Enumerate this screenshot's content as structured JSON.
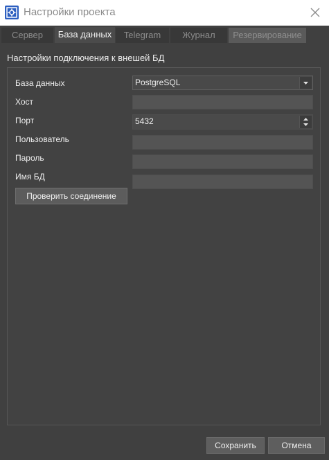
{
  "window": {
    "title": "Настройки проекта"
  },
  "tabs": [
    {
      "label": "Сервер",
      "state": "inactive"
    },
    {
      "label": "База данных",
      "state": "active"
    },
    {
      "label": "Telegram",
      "state": "inactive"
    },
    {
      "label": "Журнал",
      "state": "inactive"
    },
    {
      "label": "Резервирование",
      "state": "disabled"
    }
  ],
  "group": {
    "title": "Настройки подключения к внешей БД"
  },
  "form": {
    "db_label": "База данных",
    "db_value": "PostgreSQL",
    "host_label": "Хост",
    "host_value": "",
    "port_label": "Порт",
    "port_value": "5432",
    "user_label": "Пользователь",
    "user_value": "",
    "password_label": "Пароль",
    "password_value": "",
    "dbname_label": "Имя БД",
    "dbname_value": ""
  },
  "buttons": {
    "test": "Проверить соединение",
    "save": "Сохранить",
    "cancel": "Отмена"
  },
  "icons": {
    "app": "app-settings-icon",
    "close": "close-icon",
    "dropdown": "chevron-down-icon",
    "spin_up": "arrow-up-icon",
    "spin_down": "arrow-down-icon"
  },
  "colors": {
    "background": "#404040",
    "titlebar": "#ffffff",
    "accent_icon": "#2d5fc0"
  }
}
